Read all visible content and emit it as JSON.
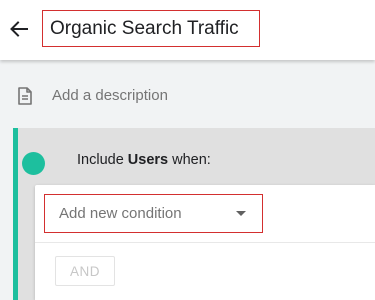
{
  "header": {
    "back_icon": "arrow-left-icon",
    "title": "Organic Search Traffic"
  },
  "description": {
    "icon": "document-icon",
    "placeholder": "Add a description"
  },
  "condition_group": {
    "accent_color": "#1dbf9e",
    "include_prefix": "Include",
    "include_subject": "Users",
    "include_suffix": "when:",
    "condition_select": {
      "placeholder": "Add new condition",
      "caret_icon": "caret-down-icon"
    },
    "and_button_label": "AND"
  },
  "colors": {
    "highlight_border": "#d32f2f",
    "accent": "#1dbf9e",
    "page_background": "#f1f3f4"
  }
}
